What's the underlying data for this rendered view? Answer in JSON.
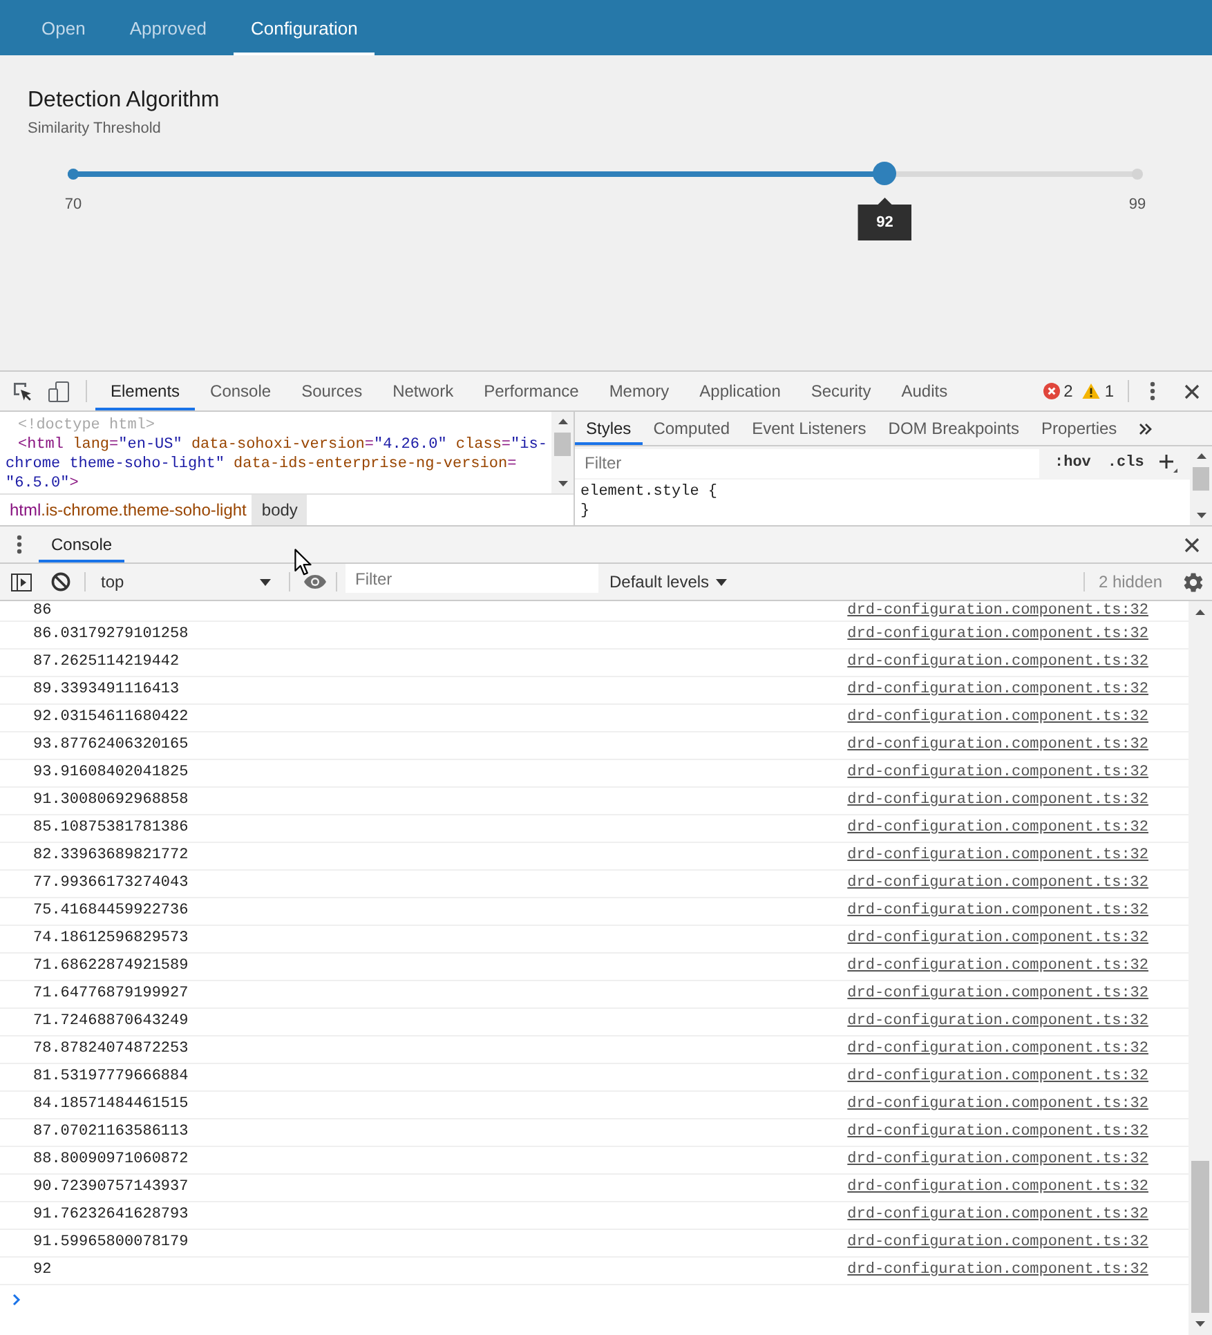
{
  "app_tabs": [
    {
      "label": "Open",
      "selected": false
    },
    {
      "label": "Approved",
      "selected": false
    },
    {
      "label": "Configuration",
      "selected": true
    }
  ],
  "configuration": {
    "title": "Detection Algorithm",
    "subtitle": "Similarity Threshold",
    "slider": {
      "level": 0.76,
      "min_label": "70",
      "max_label": "99",
      "value_tooltip": "92"
    }
  },
  "devtools": {
    "panel_tabs": [
      {
        "label": "Elements",
        "selected": true
      },
      {
        "label": "Console",
        "selected": false
      },
      {
        "label": "Sources",
        "selected": false
      },
      {
        "label": "Network",
        "selected": false
      },
      {
        "label": "Performance",
        "selected": false
      },
      {
        "label": "Memory",
        "selected": false
      },
      {
        "label": "Application",
        "selected": false
      },
      {
        "label": "Security",
        "selected": false
      },
      {
        "label": "Audits",
        "selected": false
      }
    ],
    "issues": {
      "errors": "2",
      "warnings": "1"
    },
    "dom_tree": [
      {
        "kind": "doctype",
        "text": "<!doctype html>"
      },
      {
        "kind": "element",
        "parts": [
          {
            "kind": "tag",
            "text": "<html"
          },
          {
            "kind": "name",
            "text": " lang"
          },
          {
            "kind": "punct",
            "text": "="
          },
          {
            "kind": "value",
            "text": "\"en-US\""
          },
          {
            "kind": "name",
            "text": " data-sohoxi-version"
          },
          {
            "kind": "punct",
            "text": "="
          },
          {
            "kind": "value",
            "text": "\"4.26.0\""
          },
          {
            "kind": "name",
            "text": " class"
          },
          {
            "kind": "punct",
            "text": "="
          },
          {
            "kind": "value",
            "text": "\"is-chrome theme-soho-light\""
          },
          {
            "kind": "name",
            "text": " data-ids-enterprise-ng-version"
          },
          {
            "kind": "punct",
            "text": "="
          },
          {
            "kind": "value",
            "text": "\"6.5.0\""
          },
          {
            "kind": "tag",
            "text": ">"
          }
        ]
      }
    ],
    "breadcrumbs": [
      {
        "tag": "html",
        "classes": ".is-chrome.theme-soho-light",
        "selected": false
      },
      {
        "tag": "body",
        "selected": true
      }
    ],
    "sidebar_tabs": [
      {
        "label": "Styles",
        "selected": true
      },
      {
        "label": "Computed",
        "selected": false
      },
      {
        "label": "Event Listeners",
        "selected": false
      },
      {
        "label": "DOM Breakpoints",
        "selected": false
      },
      {
        "label": "Properties",
        "selected": false
      }
    ],
    "styles_filter": {
      "placeholder": "Filter"
    },
    "style_toggles": [
      ":hov",
      ".cls"
    ],
    "style_rules": [
      "element.style {",
      "}"
    ],
    "drawer_tabs": [
      {
        "label": "Console",
        "selected": true
      }
    ],
    "console_toolbar": {
      "context": "top",
      "filter": {
        "placeholder": "Filter"
      },
      "levels": "Default levels",
      "hidden": "2 hidden"
    },
    "console_messages": [
      {
        "text": "86",
        "source": "drd-configuration.component.ts:32"
      },
      {
        "text": "86.03179279101258",
        "source": "drd-configuration.component.ts:32"
      },
      {
        "text": "87.2625114219442",
        "source": "drd-configuration.component.ts:32"
      },
      {
        "text": "89.3393491116413",
        "source": "drd-configuration.component.ts:32"
      },
      {
        "text": "92.03154611680422",
        "source": "drd-configuration.component.ts:32"
      },
      {
        "text": "93.87762406320165",
        "source": "drd-configuration.component.ts:32"
      },
      {
        "text": "93.91608402041825",
        "source": "drd-configuration.component.ts:32"
      },
      {
        "text": "91.30080692968858",
        "source": "drd-configuration.component.ts:32"
      },
      {
        "text": "85.10875381781386",
        "source": "drd-configuration.component.ts:32"
      },
      {
        "text": "82.33963689821772",
        "source": "drd-configuration.component.ts:32"
      },
      {
        "text": "77.99366173274043",
        "source": "drd-configuration.component.ts:32"
      },
      {
        "text": "75.41684459922736",
        "source": "drd-configuration.component.ts:32"
      },
      {
        "text": "74.18612596829573",
        "source": "drd-configuration.component.ts:32"
      },
      {
        "text": "71.68622874921589",
        "source": "drd-configuration.component.ts:32"
      },
      {
        "text": "71.64776879199927",
        "source": "drd-configuration.component.ts:32"
      },
      {
        "text": "71.72468870643249",
        "source": "drd-configuration.component.ts:32"
      },
      {
        "text": "78.87824074872253",
        "source": "drd-configuration.component.ts:32"
      },
      {
        "text": "81.53197779666884",
        "source": "drd-configuration.component.ts:32"
      },
      {
        "text": "84.18571484461515",
        "source": "drd-configuration.component.ts:32"
      },
      {
        "text": "87.07021163586113",
        "source": "drd-configuration.component.ts:32"
      },
      {
        "text": "88.80090971060872",
        "source": "drd-configuration.component.ts:32"
      },
      {
        "text": "90.72390757143937",
        "source": "drd-configuration.component.ts:32"
      },
      {
        "text": "91.76232641628793",
        "source": "drd-configuration.component.ts:32"
      },
      {
        "text": "91.59965800078179",
        "source": "drd-configuration.component.ts:32"
      },
      {
        "text": "92",
        "source": "drd-configuration.component.ts:32"
      }
    ]
  }
}
